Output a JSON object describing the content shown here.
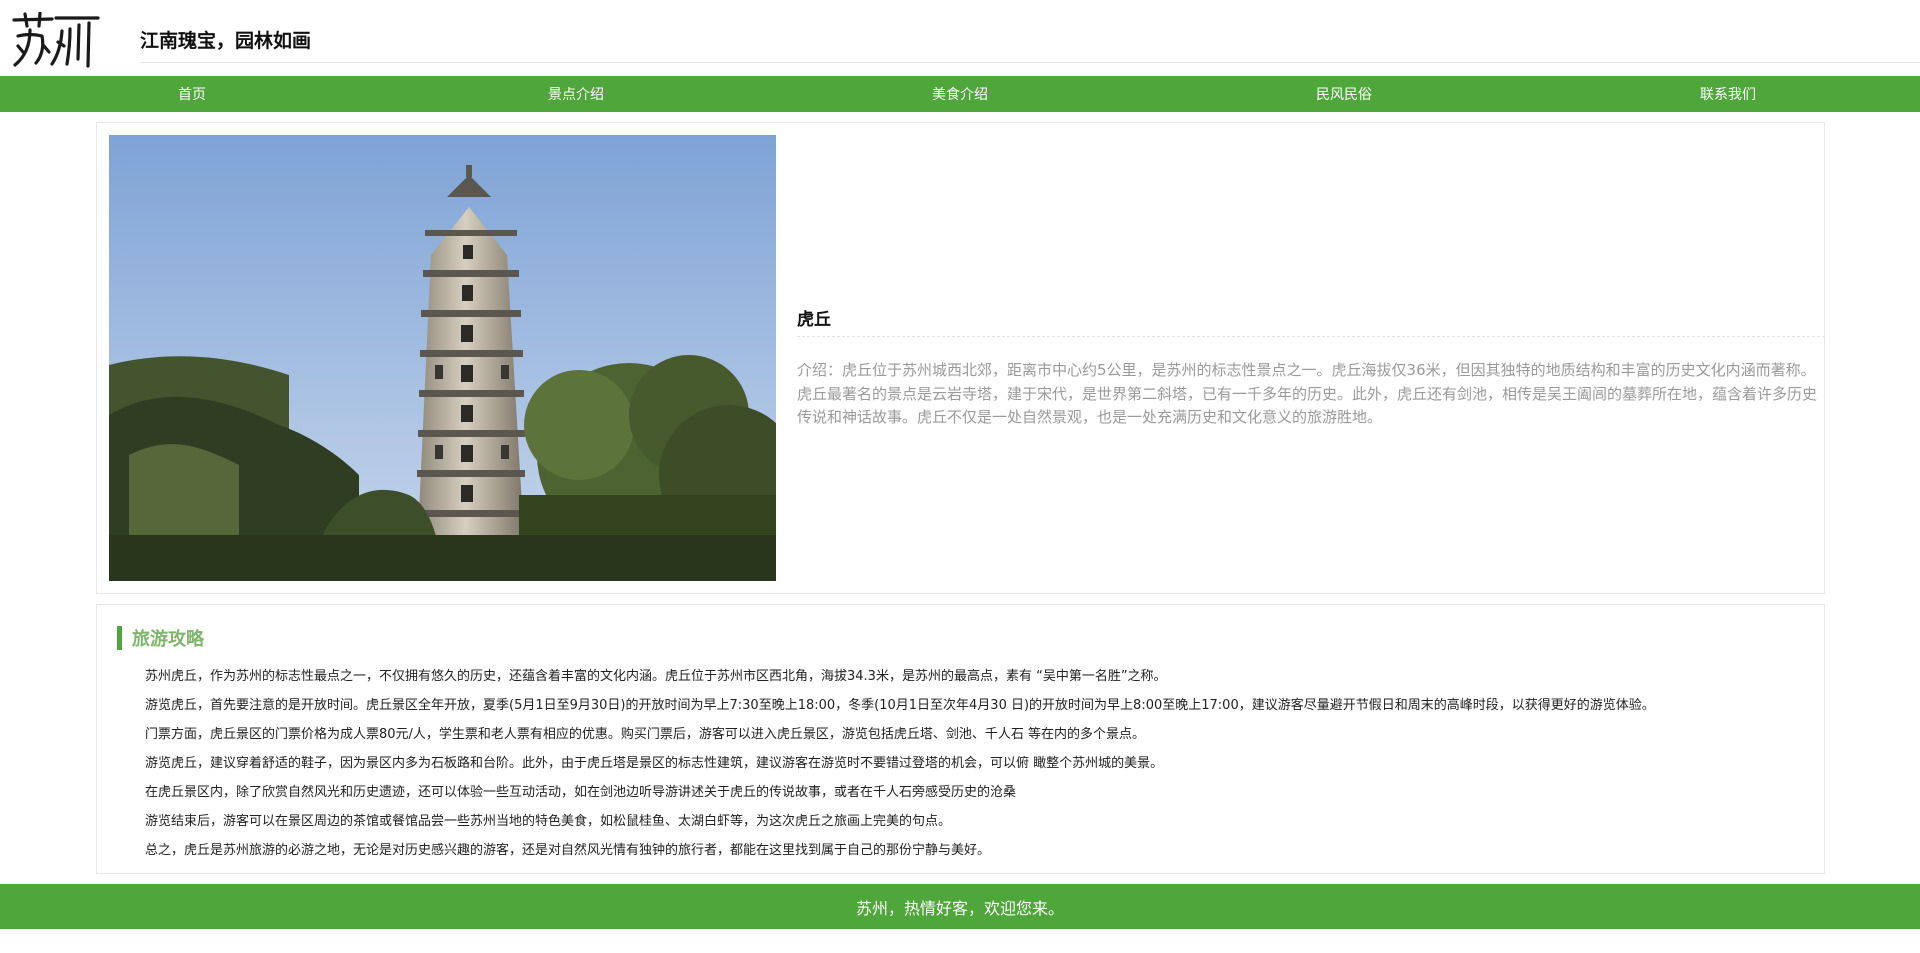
{
  "header": {
    "logo_text": "苏州",
    "slogan": "江南瑰宝，园林如画"
  },
  "nav": {
    "items": [
      {
        "label": "首页"
      },
      {
        "label": "景点介绍"
      },
      {
        "label": "美食介绍"
      },
      {
        "label": "民风民俗"
      },
      {
        "label": "联系我们"
      }
    ]
  },
  "attraction": {
    "photo_subject": "tiger-hill-pagoda",
    "title": "虎丘",
    "description": "介绍：虎丘位于苏州城西北郊，距离市中心约5公里，是苏州的标志性景点之一。虎丘海拔仅36米，但因其独特的地质结构和丰富的历史文化内涵而著称。虎丘最著名的景点是云岩寺塔，建于宋代，是世界第二斜塔，已有一千多年的历史。此外，虎丘还有剑池，相传是吴王阖闾的墓葬所在地，蕴含着许多历史传说和神话故事。虎丘不仅是一处自然景观，也是一处充满历史和文化意义的旅游胜地。"
  },
  "guide": {
    "title": "旅游攻略",
    "paragraphs": [
      "苏州虎丘，作为苏州的标志性最点之一，不仅拥有悠久的历史，还蕴含着丰富的文化内涵。虎丘位于苏州市区西北角，海拔34.3米，是苏州的最高点，素有 “吴中第一名胜”之称。",
      "游览虎丘，首先要注意的是开放时间。虎丘景区全年开放，夏季(5月1日至9月30日)的开放时间为早上7:30至晚上18:00，冬季(10月1日至次年4月30 日)的开放时间为早上8:00至晚上17:00，建议游客尽量避开节假日和周末的高峰时段，以获得更好的游览体验。",
      "门票方面，虎丘景区的门票价格为成人票80元/人，学生票和老人票有相应的优惠。购买门票后，游客可以进入虎丘景区，游览包括虎丘塔、剑池、千人石 等在内的多个景点。",
      "游览虎丘，建议穿着舒适的鞋子，因为景区内多为石板路和台阶。此外，由于虎丘塔是景区的标志性建筑，建议游客在游览时不要错过登塔的机会，可以俯 瞰整个苏州城的美景。",
      "在虎丘景区内，除了欣赏自然风光和历史遗迹，还可以体验一些互动活动，如在剑池边听导游讲述关于虎丘的传说故事，或者在千人石旁感受历史的沧桑",
      "游览结束后，游客可以在景区周边的茶馆或餐馆品尝一些苏州当地的特色美食，如松鼠桂鱼、太湖白虾等，为这次虎丘之旅画上完美的句点。",
      "总之，虎丘是苏州旅游的必游之地，无论是对历史感兴趣的游客，还是对自然风光情有独钟的旅行者，都能在这里找到属于自己的那份宁静与美好。"
    ]
  },
  "footer": {
    "text": "苏州，热情好客，欢迎您来。"
  },
  "colors": {
    "accent": "#4fa63a",
    "guide_title": "#7fb56d",
    "description_text": "#9a9a9a"
  }
}
